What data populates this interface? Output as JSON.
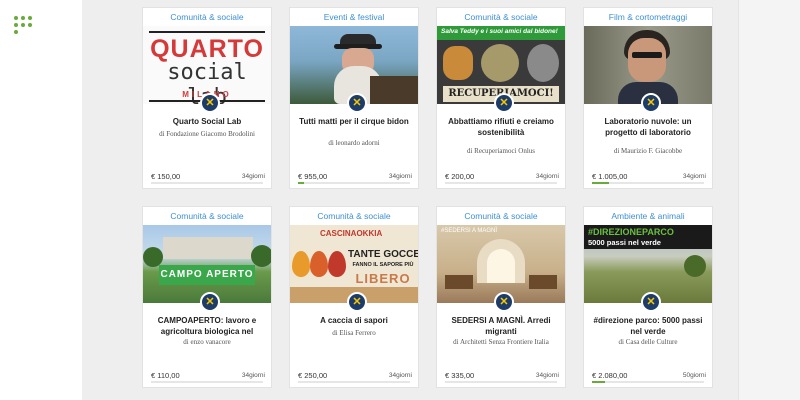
{
  "cards": [
    {
      "category": "Comunità & sociale",
      "title": "Quarto Social Lab",
      "author": "di Fondazione Giacomo Brodolini",
      "amount": "€ 150,00",
      "days": "34giorni",
      "progress": 0.0
    },
    {
      "category": "Eventi & festival",
      "title": "Tutti matti per il cirque bidon",
      "author": "di leonardo adorni",
      "amount": "€ 955,00",
      "days": "34giorni",
      "progress": 0.05
    },
    {
      "category": "Comunità & sociale",
      "title": "Abbattiamo rifiuti e creiamo sostenibilità",
      "author": "di Recuperiamoci Onlus",
      "amount": "€ 200,00",
      "days": "34giorni",
      "progress": 0.0
    },
    {
      "category": "Film & cortometraggi",
      "title": "Laboratorio nuvole: un progetto di laboratorio cinematografico",
      "author": "di Maurizio F. Giacobbe",
      "amount": "€ 1.005,00",
      "days": "34giorni",
      "progress": 0.15
    },
    {
      "category": "Comunità & sociale",
      "title": "CAMPOAPERTO: lavoro e agricoltura biologica nel carcere di",
      "author": "di enzo vanacore",
      "amount": "€ 110,00",
      "days": "34giorni",
      "progress": 0.0
    },
    {
      "category": "Comunità & sociale",
      "title": "A caccia di sapori",
      "author": "di Elisa Ferrero",
      "amount": "€ 250,00",
      "days": "34giorni",
      "progress": 0.0
    },
    {
      "category": "Comunità & sociale",
      "title": "SEDERSI A MAGNÌ. Arredi migranti",
      "author": "di Architetti Senza Frontiere Italia",
      "amount": "€ 335,00",
      "days": "34giorni",
      "progress": 0.0
    },
    {
      "category": "Ambiente & animali",
      "title": "#direzione parco: 5000 passi nel verde",
      "author": "di Casa delle Culture",
      "amount": "€ 2.080,00",
      "days": "50giorni",
      "progress": 0.12
    }
  ],
  "images": {
    "quarto_line1": "QUARTO",
    "quarto_line2": "social lab",
    "quarto_line3": "MILANO",
    "recup_banner": "Salva Teddy e i suoi amici dal bidone!",
    "recup_sign": "RECUPERIAMOCI!",
    "campo_sign": "CAMPO APERTO",
    "caccia_brand": "CASCINAOKKIA",
    "caccia_line1": "TANTE GOCCE",
    "caccia_line2": "FANNO IL SAPORE PIÙ",
    "caccia_line3": "LIBERO",
    "sedersi_tag": "#SEDERSI A MAGNÌ",
    "parco_line1": "#DIREZIONEPARCO",
    "parco_line2": "5000 passi nel verde"
  },
  "colors": {
    "category": "#3d8fd4",
    "progress": "#6aaa3a",
    "badge": "#1d3c6a",
    "badge_icon": "#f6c800"
  }
}
